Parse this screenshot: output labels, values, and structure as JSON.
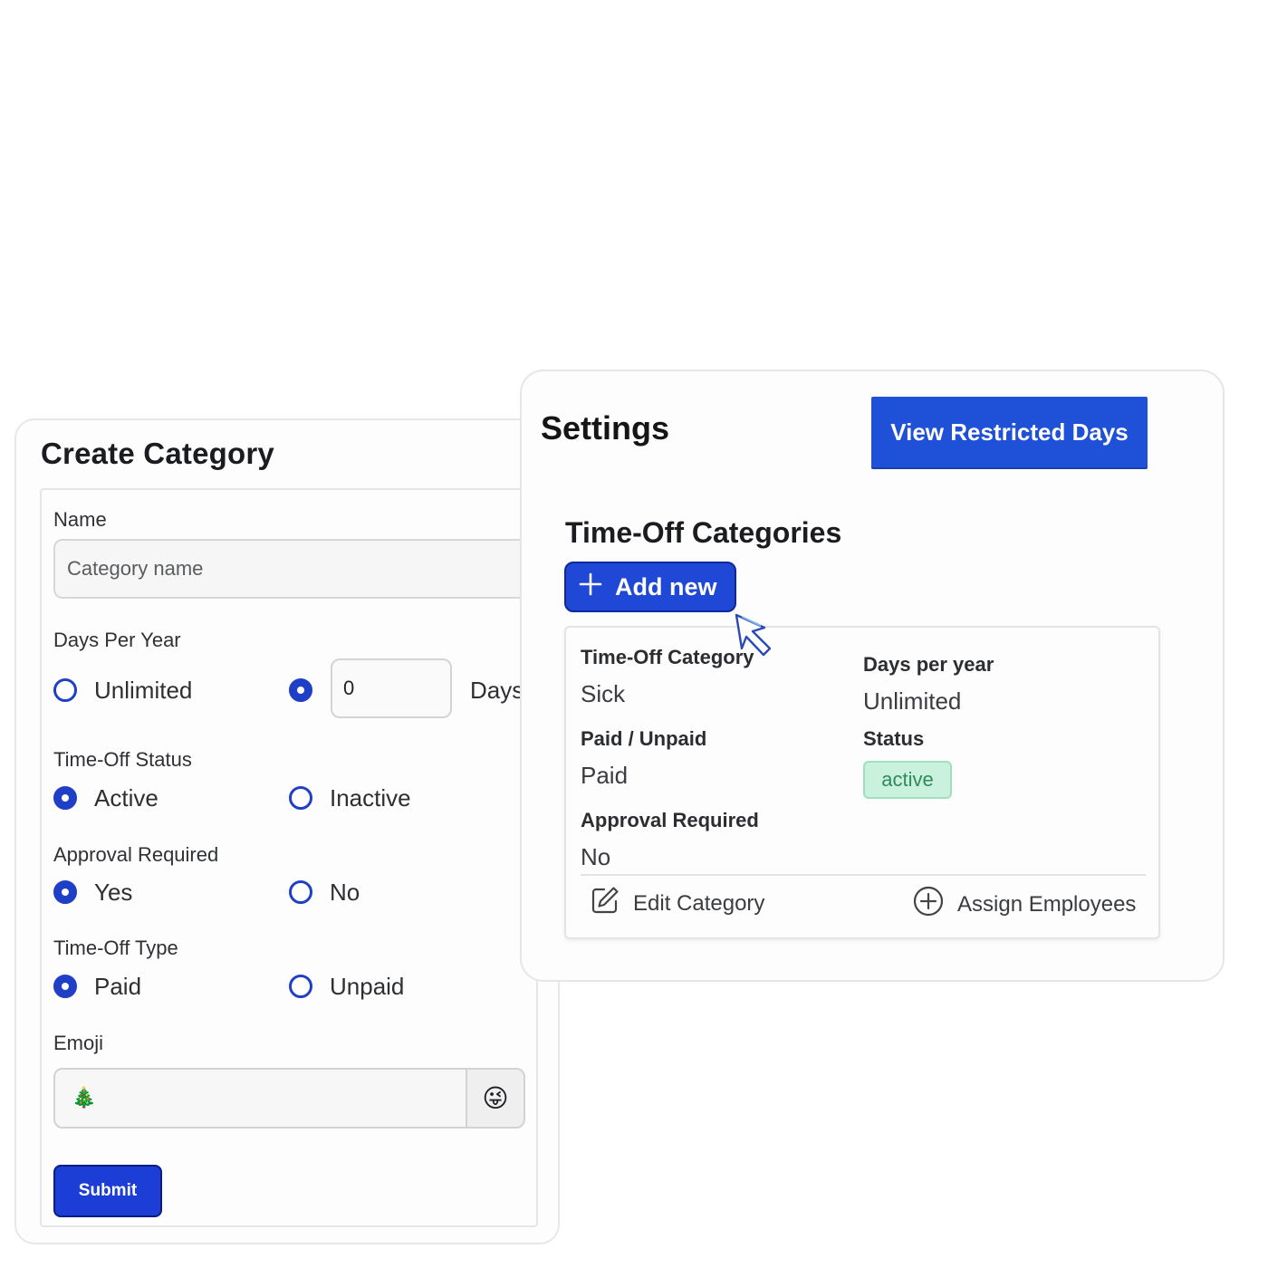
{
  "create_category": {
    "title": "Create Category",
    "name_label": "Name",
    "name_placeholder": "Category name",
    "days_label": "Days Per Year",
    "days_option_unlimited": "Unlimited",
    "days_value": "0",
    "days_unit": "Days",
    "days_selected": "custom",
    "status_label": "Time-Off Status",
    "status_options": [
      "Active",
      "Inactive"
    ],
    "status_selected": "Active",
    "approval_label": "Approval Required",
    "approval_options": [
      "Yes",
      "No"
    ],
    "approval_selected": "Yes",
    "type_label": "Time-Off Type",
    "type_options": [
      "Paid",
      "Unpaid"
    ],
    "type_selected": "Paid",
    "emoji_label": "Emoji",
    "emoji_value": "🎄",
    "emoji_picker_icon": "😜",
    "submit_label": "Submit"
  },
  "settings": {
    "title": "Settings",
    "restricted_button": "View Restricted Days",
    "section_title": "Time-Off Categories",
    "add_new_label": "Add new",
    "category": {
      "category_label": "Time-Off Category",
      "category_value": "Sick",
      "days_label": "Days per year",
      "days_value": "Unlimited",
      "paid_label": "Paid / Unpaid",
      "paid_value": "Paid",
      "status_label": "Status",
      "status_value": "active",
      "approval_label": "Approval Required",
      "approval_value": "No",
      "edit_label": "Edit Category",
      "assign_label": "Assign Employees"
    }
  },
  "colors": {
    "primary": "#1f48d6",
    "radio": "#1f3fc6",
    "badge_bg": "#c9f1dc",
    "badge_text": "#2f8a5c"
  },
  "icons": [
    "plus-icon",
    "edit-icon",
    "plus-circle-icon",
    "emoji-picker-icon",
    "cursor-pointer-icon"
  ]
}
